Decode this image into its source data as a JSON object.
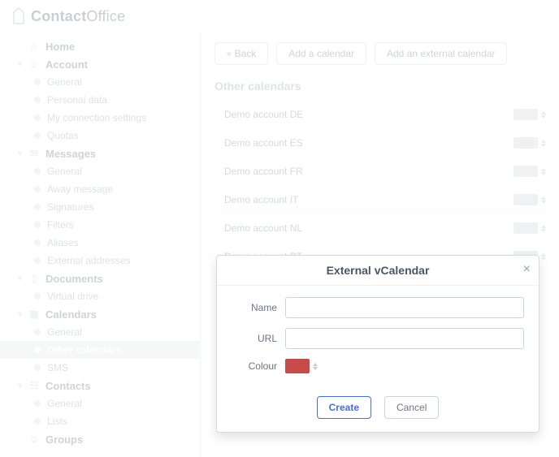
{
  "brand": {
    "name_bold": "Contact",
    "name_light": "Office"
  },
  "toolbar": {
    "back": "Back",
    "add_calendar": "Add a calendar",
    "add_external": "Add an external calendar"
  },
  "section_title": "Other calendars",
  "nav": {
    "home": "Home",
    "account": {
      "label": "Account",
      "items": [
        "General",
        "Personal data",
        "My connection settings",
        "Quotas"
      ]
    },
    "messages": {
      "label": "Messages",
      "items": [
        "General",
        "Away message",
        "Signatures",
        "Filters",
        "Aliases",
        "External addresses"
      ]
    },
    "documents": {
      "label": "Documents",
      "items": [
        "Virtual drive"
      ]
    },
    "calendars": {
      "label": "Calendars",
      "items": [
        "General",
        "Other calendars",
        "SMS"
      ],
      "active_index": 1
    },
    "contacts": {
      "label": "Contacts",
      "items": [
        "General",
        "Lists"
      ]
    },
    "groups": {
      "label": "Groups"
    }
  },
  "calendars": [
    {
      "name": "Demo account DE",
      "color": "#d7dbe0"
    },
    {
      "name": "Demo account ES",
      "color": "#d7dbe0"
    },
    {
      "name": "Demo account FR",
      "color": "#d7dbe0"
    },
    {
      "name": "Demo account IT",
      "color": "#d7dbe0"
    },
    {
      "name": "Demo account NL",
      "color": "#d7dbe0"
    },
    {
      "name": "Demo account PT",
      "color": "#d7dbe0"
    }
  ],
  "modal": {
    "title": "External vCalendar",
    "labels": {
      "name": "Name",
      "url": "URL",
      "colour": "Colour"
    },
    "values": {
      "name": "",
      "url": "",
      "colour": "#c84b4b"
    },
    "buttons": {
      "create": "Create",
      "cancel": "Cancel"
    }
  }
}
